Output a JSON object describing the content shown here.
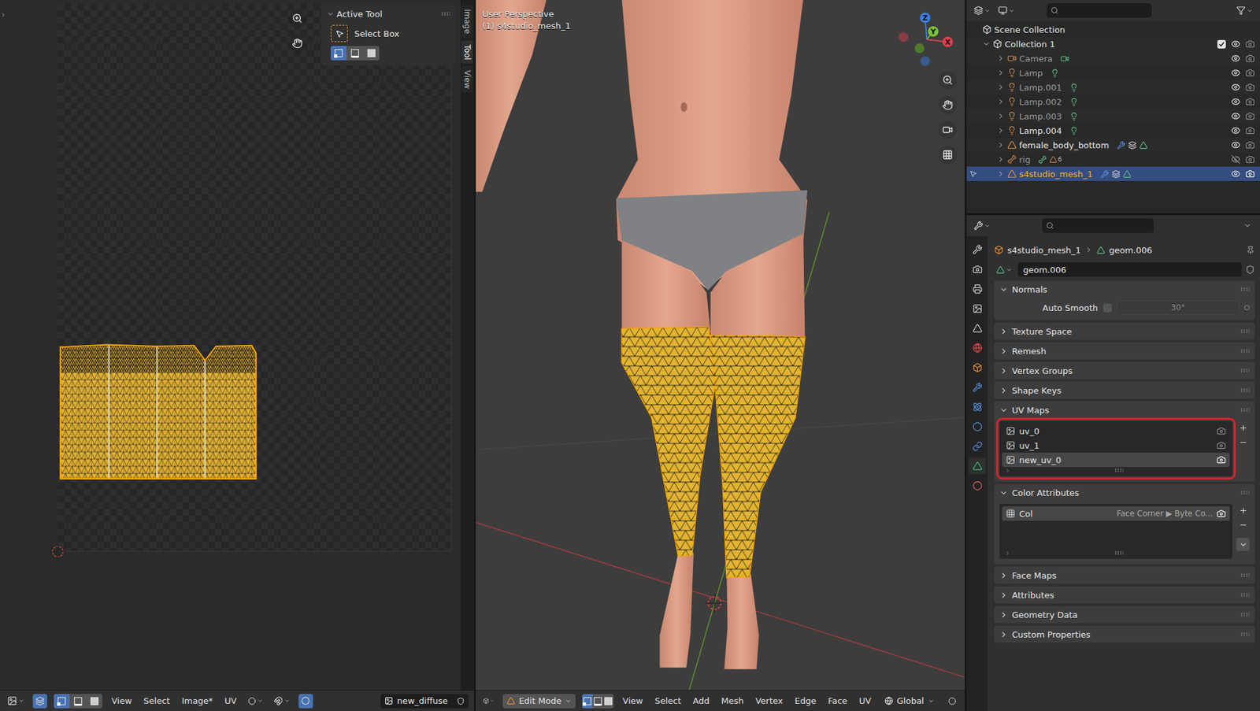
{
  "uv_editor": {
    "side_tabs": [
      {
        "label": "Image",
        "selected": false
      },
      {
        "label": "Tool",
        "selected": true
      },
      {
        "label": "View",
        "selected": false
      }
    ],
    "active_tool": {
      "title": "Active Tool",
      "expanded": true,
      "tool": "Select Box",
      "modes": [
        {
          "selected": true
        },
        {
          "selected": false
        },
        {
          "selected": false
        }
      ]
    },
    "header": {
      "sync_selection": true,
      "select_modes": [
        {
          "selected": true
        },
        {
          "selected": false
        },
        {
          "selected": false
        }
      ],
      "menus": [
        "View",
        "Select",
        "Image*",
        "UV"
      ],
      "proportional": true,
      "image": "new_diffuse"
    }
  },
  "viewport": {
    "title": "User Perspective",
    "object": "(1) s4studio_mesh_1",
    "axes": [
      "Z",
      "Y",
      "X"
    ],
    "header": {
      "mode": "Edit Mode",
      "select_modes": [
        {
          "selected": true
        },
        {
          "selected": false
        },
        {
          "selected": false
        }
      ],
      "menus": [
        "View",
        "Select",
        "Add",
        "Mesh",
        "Vertex",
        "Edge",
        "Face",
        "UV"
      ],
      "orientation": "Global"
    }
  },
  "outliner": {
    "root": "Scene Collection",
    "collection": {
      "name": "Collection 1",
      "checked": true,
      "expanded": true
    },
    "items": [
      {
        "name": "Camera",
        "kind": "camera",
        "dimmed": true,
        "visible": true,
        "selected": false,
        "expanded": false
      },
      {
        "name": "Lamp",
        "kind": "lamp",
        "dimmed": true,
        "visible": true,
        "selected": false,
        "expanded": false
      },
      {
        "name": "Lamp.001",
        "kind": "lamp",
        "dimmed": true,
        "visible": true,
        "selected": false,
        "expanded": false
      },
      {
        "name": "Lamp.002",
        "kind": "lamp",
        "dimmed": true,
        "visible": true,
        "selected": false,
        "expanded": false
      },
      {
        "name": "Lamp.003",
        "kind": "lamp",
        "dimmed": true,
        "visible": true,
        "selected": false,
        "expanded": false
      },
      {
        "name": "Lamp.004",
        "kind": "lamp",
        "dimmed": false,
        "visible": true,
        "selected": false,
        "expanded": false
      },
      {
        "name": "female_body_bottom",
        "kind": "mesh",
        "dimmed": false,
        "visible": true,
        "selected": false,
        "expanded": false
      },
      {
        "name": "rig",
        "kind": "armature",
        "dimmed": true,
        "visible": false,
        "selected": false,
        "expanded": false,
        "badge": "6"
      },
      {
        "name": "s4studio_mesh_1",
        "kind": "mesh",
        "dimmed": false,
        "visible": true,
        "selected": true,
        "expanded": false
      }
    ]
  },
  "properties": {
    "tabs": [
      {
        "kind": "tool",
        "selected": false
      },
      {
        "kind": "render",
        "selected": false
      },
      {
        "kind": "output",
        "selected": false
      },
      {
        "kind": "view_layer",
        "selected": false
      },
      {
        "kind": "scene",
        "selected": false
      },
      {
        "kind": "world",
        "selected": false
      },
      {
        "kind": "object",
        "selected": false
      },
      {
        "kind": "modifiers",
        "selected": false
      },
      {
        "kind": "particles",
        "selected": false
      },
      {
        "kind": "physics",
        "selected": false
      },
      {
        "kind": "constraints",
        "selected": false
      },
      {
        "kind": "data",
        "selected": true
      },
      {
        "kind": "material",
        "selected": false
      }
    ],
    "breadcrumb": [
      "s4studio_mesh_1",
      "geom.006"
    ],
    "datablock": "geom.006",
    "panels": [
      {
        "title": "Normals",
        "expanded": true,
        "kind": "normals",
        "auto_smooth": {
          "label": "Auto Smooth",
          "checked": false,
          "angle": "30°"
        }
      },
      {
        "title": "Texture Space",
        "expanded": false,
        "kind": "plain"
      },
      {
        "title": "Remesh",
        "expanded": false,
        "kind": "plain"
      },
      {
        "title": "Vertex Groups",
        "expanded": false,
        "kind": "plain"
      },
      {
        "title": "Shape Keys",
        "expanded": false,
        "kind": "plain"
      },
      {
        "title": "UV Maps",
        "expanded": true,
        "kind": "uv_list",
        "highlighted": true,
        "items": [
          {
            "name": "uv_0",
            "selected": false,
            "render_active": false
          },
          {
            "name": "uv_1",
            "selected": false,
            "render_active": false
          },
          {
            "name": "new_uv_0",
            "selected": true,
            "render_active": true
          }
        ]
      },
      {
        "title": "Color Attributes",
        "expanded": true,
        "kind": "color_list",
        "items": [
          {
            "name": "Col",
            "info": "Face Corner ▶ Byte Co...",
            "selected": true,
            "render_active": true
          }
        ]
      },
      {
        "title": "Face Maps",
        "expanded": false,
        "kind": "plain"
      },
      {
        "title": "Attributes",
        "expanded": false,
        "kind": "plain"
      },
      {
        "title": "Geometry Data",
        "expanded": false,
        "kind": "plain"
      },
      {
        "title": "Custom Properties",
        "expanded": false,
        "kind": "plain"
      }
    ]
  }
}
